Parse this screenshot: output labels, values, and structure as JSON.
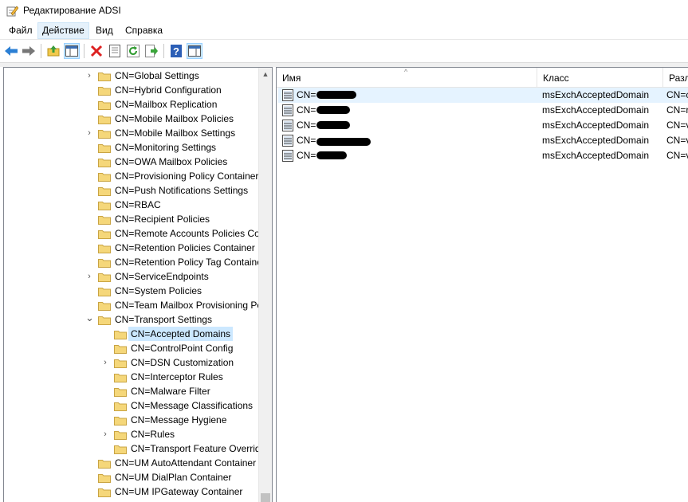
{
  "window": {
    "title": "Редактирование ADSI",
    "icon": "pencil-note-icon"
  },
  "menu": [
    {
      "label": "Файл",
      "active": false
    },
    {
      "label": "Действие",
      "active": true
    },
    {
      "label": "Вид",
      "active": false
    },
    {
      "label": "Справка",
      "active": false
    }
  ],
  "toolbar": {
    "buttons": [
      "back-arrow-icon",
      "forward-arrow-icon",
      "up-folder-icon",
      "show-hide-tree-icon",
      "delete-icon",
      "properties-icon",
      "refresh-icon",
      "export-list-icon",
      "help-icon",
      "show-action-pane-icon"
    ]
  },
  "tree": {
    "items": [
      {
        "label": "CN=Global Settings",
        "expandable": true,
        "expanded": false,
        "level": 0
      },
      {
        "label": "CN=Hybrid Configuration",
        "expandable": false,
        "level": 0
      },
      {
        "label": "CN=Mailbox Replication",
        "expandable": false,
        "level": 0
      },
      {
        "label": "CN=Mobile Mailbox Policies",
        "expandable": false,
        "level": 0
      },
      {
        "label": "CN=Mobile Mailbox Settings",
        "expandable": true,
        "expanded": false,
        "level": 0
      },
      {
        "label": "CN=Monitoring Settings",
        "expandable": false,
        "level": 0
      },
      {
        "label": "CN=OWA Mailbox Policies",
        "expandable": false,
        "level": 0
      },
      {
        "label": "CN=Provisioning Policy Container",
        "expandable": false,
        "level": 0
      },
      {
        "label": "CN=Push Notifications Settings",
        "expandable": false,
        "level": 0
      },
      {
        "label": "CN=RBAC",
        "expandable": false,
        "level": 0
      },
      {
        "label": "CN=Recipient Policies",
        "expandable": false,
        "level": 0
      },
      {
        "label": "CN=Remote Accounts Policies Co",
        "expandable": false,
        "level": 0
      },
      {
        "label": "CN=Retention Policies Container",
        "expandable": false,
        "level": 0
      },
      {
        "label": "CN=Retention Policy Tag Containe",
        "expandable": false,
        "level": 0
      },
      {
        "label": "CN=ServiceEndpoints",
        "expandable": true,
        "expanded": false,
        "level": 0
      },
      {
        "label": "CN=System Policies",
        "expandable": false,
        "level": 0
      },
      {
        "label": "CN=Team Mailbox Provisioning Po",
        "expandable": false,
        "level": 0
      },
      {
        "label": "CN=Transport Settings",
        "expandable": true,
        "expanded": true,
        "level": 0
      },
      {
        "label": "CN=Accepted Domains",
        "expandable": false,
        "level": 1,
        "selected": true
      },
      {
        "label": "CN=ControlPoint Config",
        "expandable": false,
        "level": 1
      },
      {
        "label": "CN=DSN Customization",
        "expandable": true,
        "expanded": false,
        "level": 1
      },
      {
        "label": "CN=Interceptor Rules",
        "expandable": false,
        "level": 1
      },
      {
        "label": "CN=Malware Filter",
        "expandable": false,
        "level": 1
      },
      {
        "label": "CN=Message Classifications",
        "expandable": false,
        "level": 1
      },
      {
        "label": "CN=Message Hygiene",
        "expandable": false,
        "level": 1
      },
      {
        "label": "CN=Rules",
        "expandable": true,
        "expanded": false,
        "level": 1
      },
      {
        "label": "CN=Transport Feature Override",
        "expandable": false,
        "level": 1
      },
      {
        "label": "CN=UM AutoAttendant Container",
        "expandable": false,
        "level": 0
      },
      {
        "label": "CN=UM DialPlan Container",
        "expandable": false,
        "level": 0
      },
      {
        "label": "CN=UM IPGateway Container",
        "expandable": false,
        "level": 0
      }
    ]
  },
  "list": {
    "columns": [
      "Имя",
      "Класс",
      "Разли"
    ],
    "rows": [
      {
        "name": "CN=",
        "class": "msExchAcceptedDomain",
        "dn": "CN=c",
        "selected": true
      },
      {
        "name": "CN=",
        "class": "msExchAcceptedDomain",
        "dn": "CN=r",
        "selected": false
      },
      {
        "name": "CN=",
        "class": "msExchAcceptedDomain",
        "dn": "CN=v",
        "selected": false
      },
      {
        "name": "CN=",
        "class": "msExchAcceptedDomain",
        "dn": "CN=v",
        "selected": false
      },
      {
        "name": "CN=",
        "class": "msExchAcceptedDomain",
        "dn": "CN=v",
        "selected": false
      }
    ]
  },
  "colors": {
    "selection": "#cce8ff",
    "accent": "#0078d7",
    "folder": "#f5d77a"
  }
}
